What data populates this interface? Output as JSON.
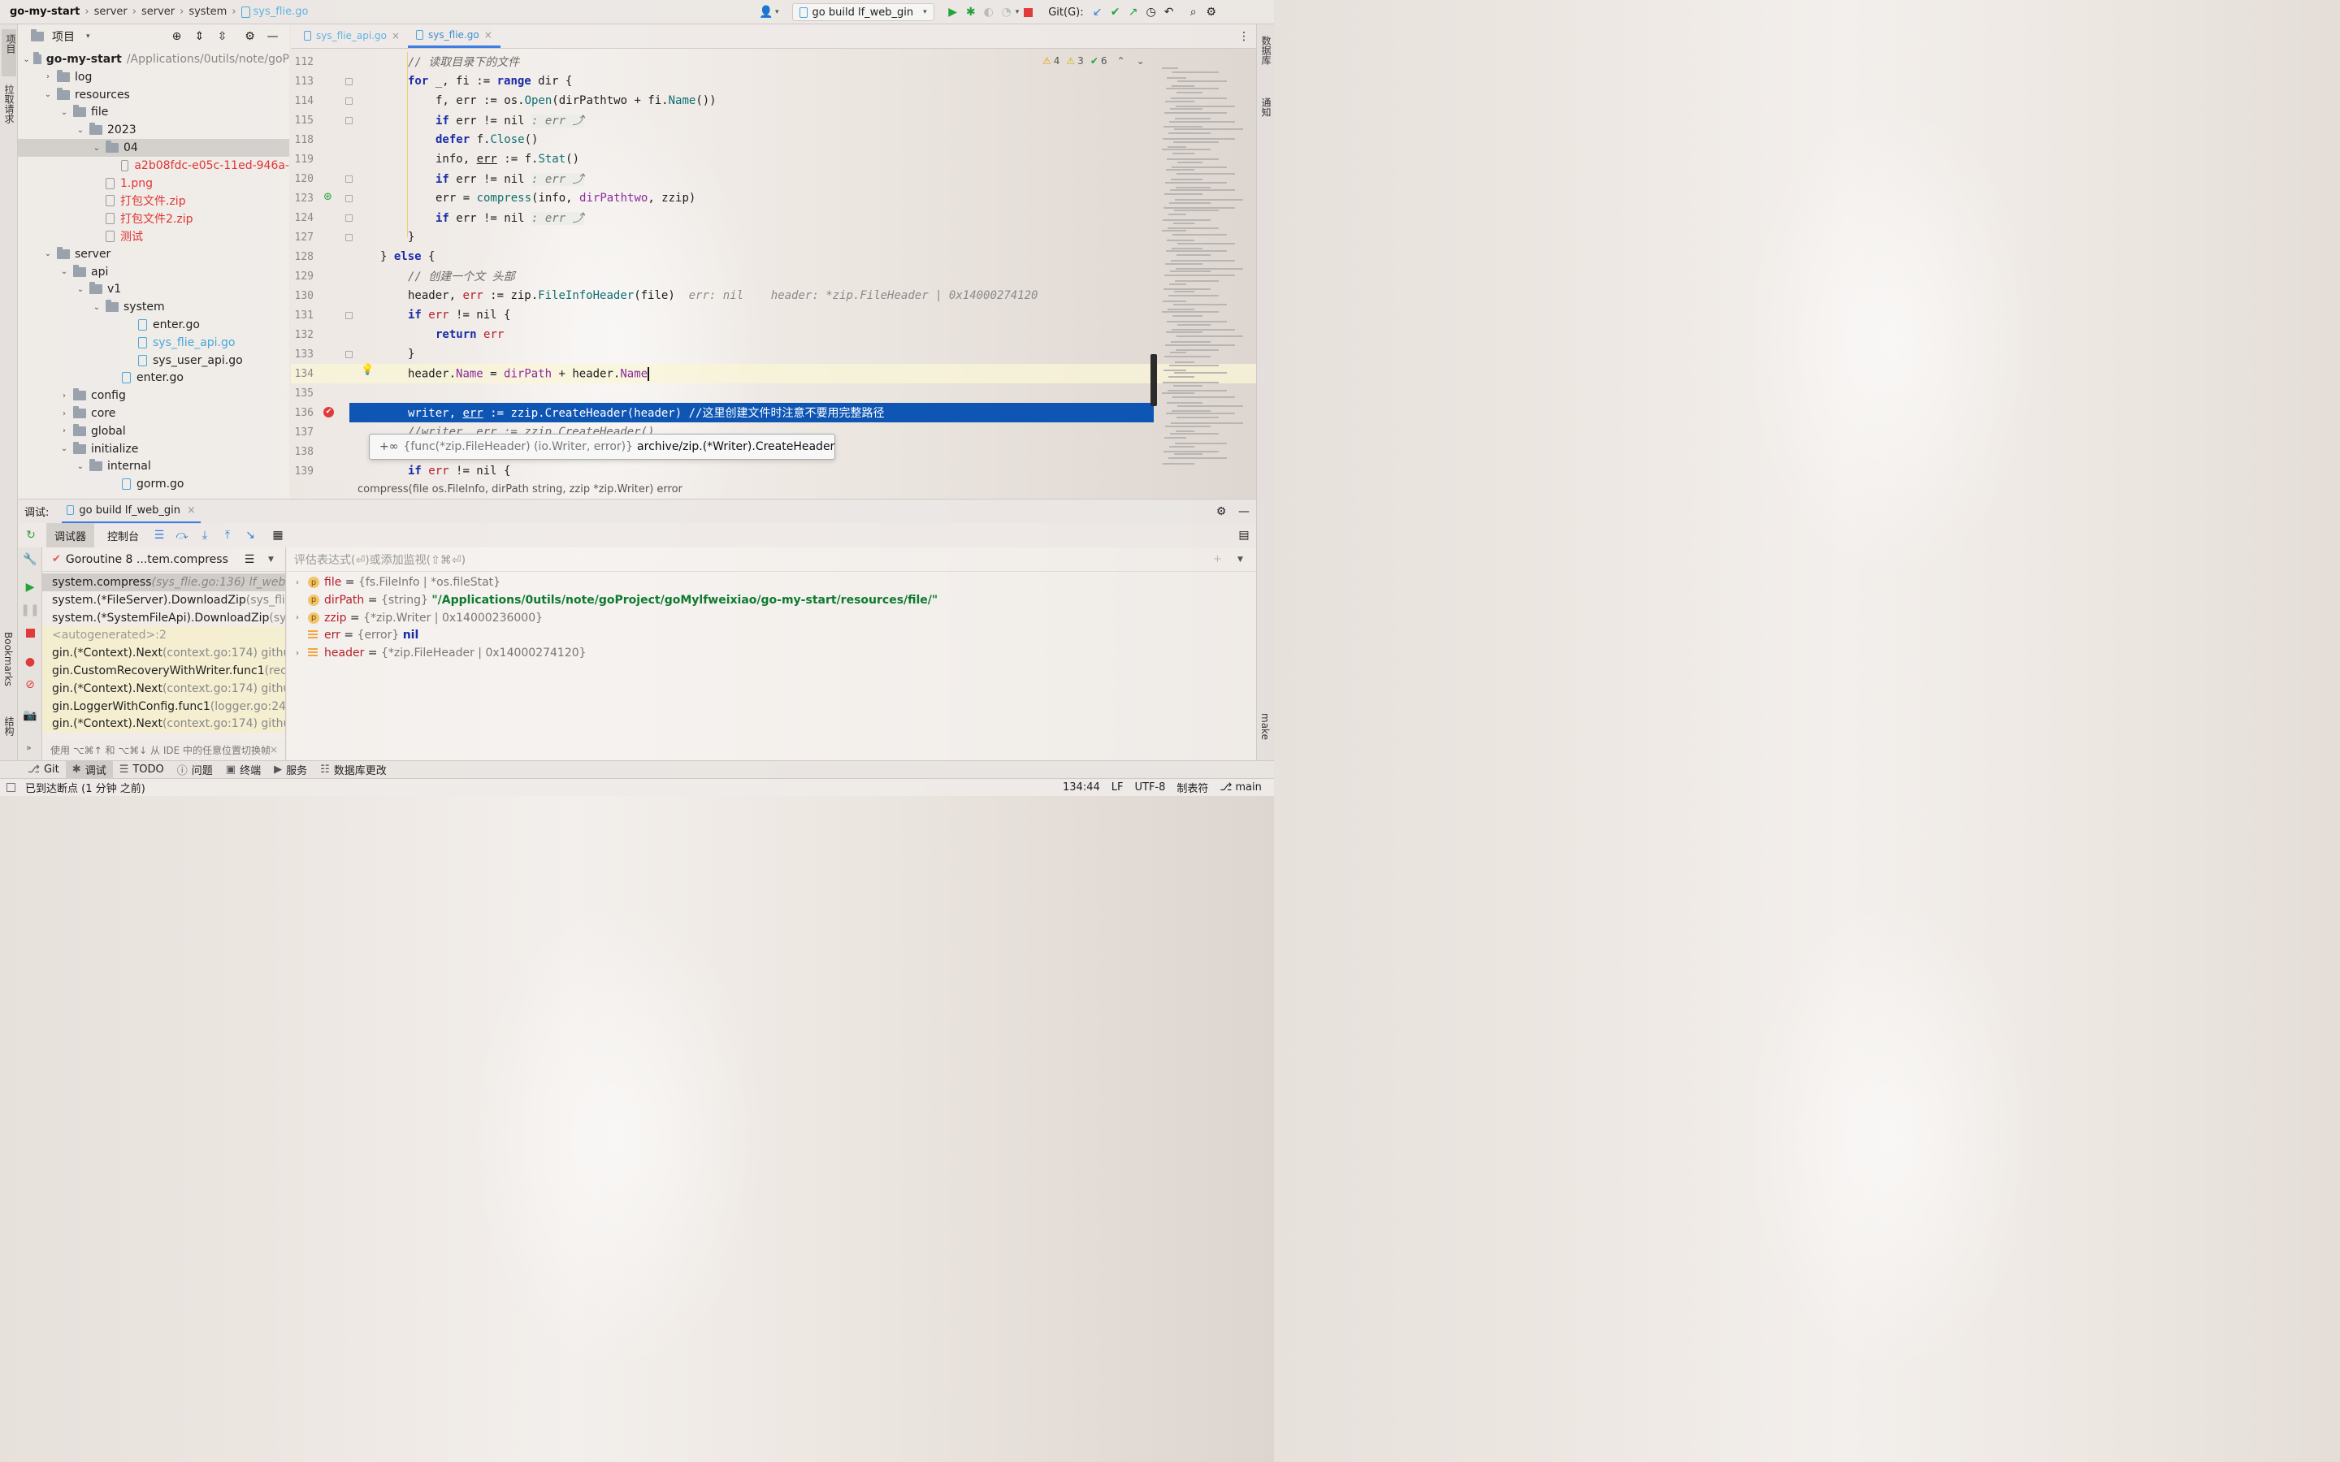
{
  "breadcrumb": {
    "project": "go-my-start",
    "items": [
      "server",
      "server",
      "system"
    ],
    "file": "sys_flie.go"
  },
  "toolbar": {
    "run_config": "go build lf_web_gin",
    "git_label": "Git(G):"
  },
  "left_strip": {
    "project": "项目",
    "pull_requests": "拉取请求",
    "bookmarks": "Bookmarks",
    "structure": "结构"
  },
  "right_strip": {
    "database": "数据库",
    "notifications": "通知",
    "make": "make"
  },
  "project_panel": {
    "title": "项目"
  },
  "tree": [
    {
      "label": "go-my-start",
      "extra": "/Applications/0utils/note/goP",
      "indent": 0,
      "arrow": "down",
      "icon": "folder",
      "style": "bold"
    },
    {
      "label": "log",
      "indent": 1,
      "arrow": "right",
      "icon": "folder"
    },
    {
      "label": "resources",
      "indent": 1,
      "arrow": "down",
      "icon": "folder"
    },
    {
      "label": "file",
      "indent": 2,
      "arrow": "down",
      "icon": "folder"
    },
    {
      "label": "2023",
      "indent": 3,
      "arrow": "down",
      "icon": "folder"
    },
    {
      "label": "04",
      "indent": 4,
      "arrow": "down",
      "icon": "folder",
      "selected": true
    },
    {
      "label": "a2b08fdc-e05c-11ed-946a-",
      "indent": 6,
      "arrow": "",
      "icon": "file",
      "style": "red"
    },
    {
      "label": "1.png",
      "indent": 4,
      "arrow": "",
      "icon": "file",
      "style": "red"
    },
    {
      "label": "打包文件.zip",
      "indent": 4,
      "arrow": "",
      "icon": "file",
      "style": "red"
    },
    {
      "label": "打包文件2.zip",
      "indent": 4,
      "arrow": "",
      "icon": "file",
      "style": "red"
    },
    {
      "label": "测试",
      "indent": 4,
      "arrow": "",
      "icon": "file",
      "style": "red"
    },
    {
      "label": "server",
      "indent": 1,
      "arrow": "down",
      "icon": "folder"
    },
    {
      "label": "api",
      "indent": 2,
      "arrow": "down",
      "icon": "folder"
    },
    {
      "label": "v1",
      "indent": 3,
      "arrow": "down",
      "icon": "folder"
    },
    {
      "label": "system",
      "indent": 4,
      "arrow": "down",
      "icon": "folder"
    },
    {
      "label": "enter.go",
      "indent": 6,
      "arrow": "",
      "icon": "go"
    },
    {
      "label": "sys_flie_api.go",
      "indent": 6,
      "arrow": "",
      "icon": "go",
      "style": "blue"
    },
    {
      "label": "sys_user_api.go",
      "indent": 6,
      "arrow": "",
      "icon": "go"
    },
    {
      "label": "enter.go",
      "indent": 5,
      "arrow": "",
      "icon": "go"
    },
    {
      "label": "config",
      "indent": 2,
      "arrow": "right",
      "icon": "folder"
    },
    {
      "label": "core",
      "indent": 2,
      "arrow": "right",
      "icon": "folder"
    },
    {
      "label": "global",
      "indent": 2,
      "arrow": "right",
      "icon": "folder"
    },
    {
      "label": "initialize",
      "indent": 2,
      "arrow": "down",
      "icon": "folder"
    },
    {
      "label": "internal",
      "indent": 3,
      "arrow": "down",
      "icon": "folder"
    },
    {
      "label": "gorm.go",
      "indent": 5,
      "arrow": "",
      "icon": "go"
    }
  ],
  "editor_tabs": [
    {
      "label": "sys_flie_api.go",
      "active": false
    },
    {
      "label": "sys_flie.go",
      "active": true
    }
  ],
  "inspections": {
    "warnings": "4",
    "weak": "3",
    "ok": "6"
  },
  "code_lines": [
    {
      "num": "112",
      "html": "<span class=\"cm\">// 读取目录下的文件</span>",
      "indent": 2
    },
    {
      "num": "113",
      "html": "<span class=\"kw\">for</span> _, fi := <span class=\"kw\">range</span> dir {",
      "indent": 2
    },
    {
      "num": "114",
      "html": "f, err := os.<span class=\"fn\">Open</span>(dirPathtwo + fi.<span class=\"fn\">Name</span>())",
      "indent": 3
    },
    {
      "num": "115",
      "html": "<span class=\"kw\">if</span> err != nil <span class=\"hint\">: err ⤴</span>",
      "indent": 3
    },
    {
      "num": "118",
      "html": "<span class=\"kw\">defer</span> f.<span class=\"fn\">Close</span>()",
      "indent": 3
    },
    {
      "num": "119",
      "html": "info, <u>err</u> := f.<span class=\"fn\">Stat</span>()",
      "indent": 3
    },
    {
      "num": "120",
      "html": "<span class=\"kw\">if</span> err != nil <span class=\"hint\">: err ⤴</span>",
      "indent": 3
    },
    {
      "num": "123",
      "html": "err = <span class=\"fn\">compress</span>(info, <span class=\"pur\">dirPathtwo</span>, zzip)",
      "indent": 3
    },
    {
      "num": "124",
      "html": "<span class=\"kw\">if</span> err != nil <span class=\"hint\">: err ⤴</span>",
      "indent": 3
    },
    {
      "num": "127",
      "html": "}",
      "indent": 2
    },
    {
      "num": "128",
      "html": "} <span class=\"kw\">else</span> {",
      "indent": 1
    },
    {
      "num": "129",
      "html": "<span class=\"cm\">// 创建一个文 头部</span>",
      "indent": 2
    },
    {
      "num": "130",
      "html": "header, <span class=\"vname\">err</span> := zip.<span class=\"fn\">FileInfoHeader</span>(file)  <span class=\"inl\">err: nil    header: *zip.FileHeader | 0x14000274120</span>",
      "indent": 2
    },
    {
      "num": "131",
      "html": "<span class=\"kw\">if</span> <span class=\"vname\">err</span> != nil {",
      "indent": 2
    },
    {
      "num": "132",
      "html": "<span class=\"kw\">return</span> <span class=\"vname\">err</span>",
      "indent": 3
    },
    {
      "num": "133",
      "html": "}",
      "indent": 2
    },
    {
      "num": "134",
      "html": "header.<span class=\"pur\">Name</span> = <span class=\"pur\">dirPath</span> + header.<span class=\"pur\">Name</span>",
      "indent": 2
    },
    {
      "num": "135",
      "html": "",
      "indent": 2
    },
    {
      "num": "136",
      "html": "writer, <u>err</u> := zzip.CreateHeader(header) //这里创建文件时注意不要用完整路径",
      "indent": 2
    },
    {
      "num": "137",
      "html": "<span class=\"cm\">//writer, err := zzip.CreateHeader()</span>",
      "indent": 2
    },
    {
      "num": "138",
      "html": "",
      "indent": 2
    },
    {
      "num": "139",
      "html": "<span class=\"kw\">if</span> <span class=\"vname\">err</span> != nil {",
      "indent": 2
    }
  ],
  "popup": {
    "type_sig": "{func(*zip.FileHeader) (io.Writer, error)}",
    "target": "archive/zip.(*Writer).CreateHeader"
  },
  "signature": "compress(file os.FileInfo, dirPath string, zzip *zip.Writer) error",
  "debug": {
    "label": "调试:",
    "session": "go build lf_web_gin",
    "tab_debugger": "调试器",
    "tab_console": "控制台",
    "goroutine": "Goroutine 8 ...tem.compress",
    "eval_placeholder": "评估表达式(⏎)或添加监视(⇧⌘⏎)",
    "hint": "使用 ⌥⌘↑ 和 ⌥⌘↓ 从 IDE 中的任意位置切换帧"
  },
  "frames": [
    {
      "name": "system.compress",
      "loc": " (sys_flie.go:136) lf_web",
      "type": "sel"
    },
    {
      "name": "system.(*FileServer).DownloadZip",
      "loc": " (sys_fli",
      "type": "app"
    },
    {
      "name": "system.(*SystemFileApi).DownloadZip",
      "loc": " (sys",
      "type": "app"
    },
    {
      "name": "<autogenerated>:2",
      "loc": "",
      "type": "auto"
    },
    {
      "name": "gin.(*Context).Next",
      "loc": " (context.go:174) githu",
      "type": "lib"
    },
    {
      "name": "gin.CustomRecoveryWithWriter.func1",
      "loc": " (rec",
      "type": "lib"
    },
    {
      "name": "gin.(*Context).Next",
      "loc": " (context.go:174) githu",
      "type": "lib"
    },
    {
      "name": "gin.LoggerWithConfig.func1",
      "loc": " (logger.go:24",
      "type": "lib"
    },
    {
      "name": "gin.(*Context).Next",
      "loc": " (context.go:174) githu",
      "type": "lib"
    }
  ],
  "variables": [
    {
      "name": "file",
      "eq": " = ",
      "type": "{fs.FileInfo | *os.fileStat}",
      "value": "",
      "expand": true,
      "badge": "p"
    },
    {
      "name": "dirPath",
      "eq": " = ",
      "type": "{string} ",
      "value": "\"/Applications/0utils/note/goProject/goMylfweixiao/go-my-start/resources/file/\"",
      "expand": false,
      "badge": "p"
    },
    {
      "name": "zzip",
      "eq": " = ",
      "type": "{*zip.Writer | 0x14000236000}",
      "value": "",
      "expand": true,
      "badge": "p"
    },
    {
      "name": "err",
      "eq": " = ",
      "type": "{error} ",
      "value": "nil",
      "expand": false,
      "badge": "v"
    },
    {
      "name": "header",
      "eq": " = ",
      "type": "{*zip.FileHeader | 0x14000274120}",
      "value": "",
      "expand": true,
      "badge": "v"
    }
  ],
  "tool_tabs": [
    "Git",
    "调试",
    "TODO",
    "问题",
    "终端",
    "服务",
    "数据库更改"
  ],
  "status": {
    "message": "已到达断点 (1 分钟 之前)",
    "position": "134:44",
    "line_sep": "LF",
    "encoding": "UTF-8",
    "indent": "制表符",
    "branch": "main"
  },
  "colors": {
    "selection": "#0f56b4",
    "accent": "#3d7fe0",
    "run_green": "#22a33b",
    "stop_red": "#e03b3b"
  }
}
